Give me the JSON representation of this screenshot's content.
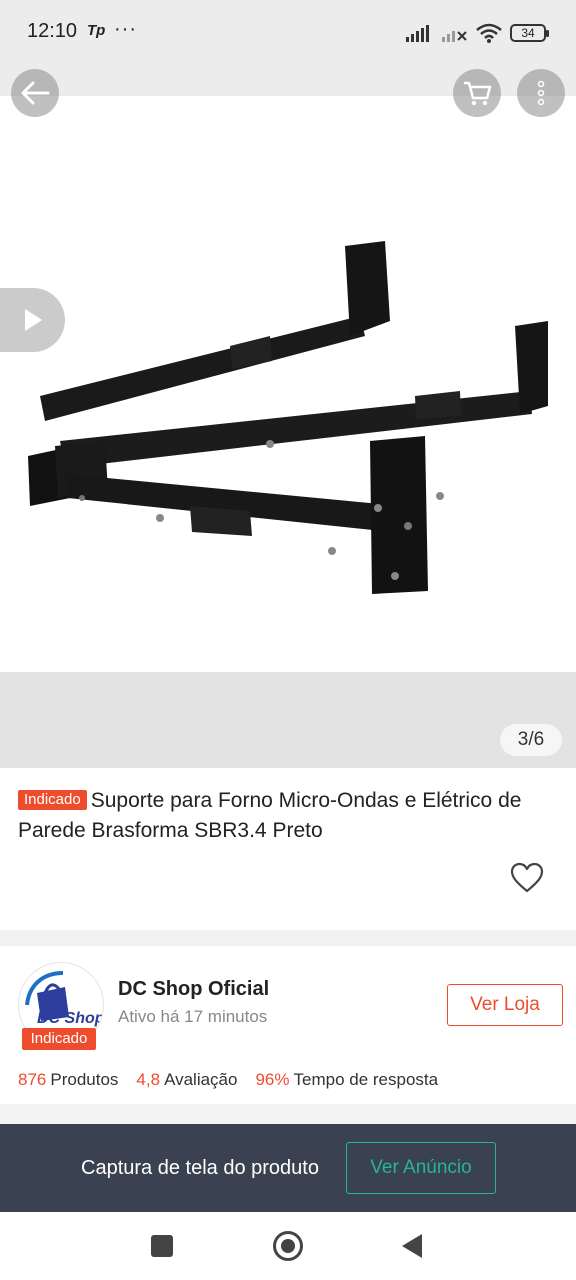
{
  "status_bar": {
    "time": "12:10",
    "carrier": "Tp",
    "dots": "···",
    "battery": "34"
  },
  "gallery": {
    "page_counter": "3/6",
    "icons": {
      "back": "arrow-left-icon",
      "cart": "cart-icon",
      "more": "more-vertical-icon",
      "play": "play-icon"
    }
  },
  "product": {
    "badge": "Indicado",
    "title": "Suporte para Forno Micro-Ondas e Elétrico de Parede Brasforma SBR3.4 Preto",
    "favorite_icon": "heart-icon"
  },
  "shop": {
    "name": "DC Shop Oficial",
    "status": "Ativo há 17 minutos",
    "logo_text": "DC Shop",
    "badge": "Indicado",
    "visit_button": "Ver Loja",
    "stats": [
      {
        "value": "876",
        "label": "Produtos"
      },
      {
        "value": "4,8",
        "label": "Avaliação"
      },
      {
        "value": "96%",
        "label": "Tempo de resposta"
      }
    ]
  },
  "capture_bar": {
    "label": "Captura de tela do produto",
    "button": "Ver Anúncio"
  },
  "colors": {
    "accent": "#ee4d2d",
    "teal": "#27b39a",
    "capture_bg": "#3a4150"
  }
}
